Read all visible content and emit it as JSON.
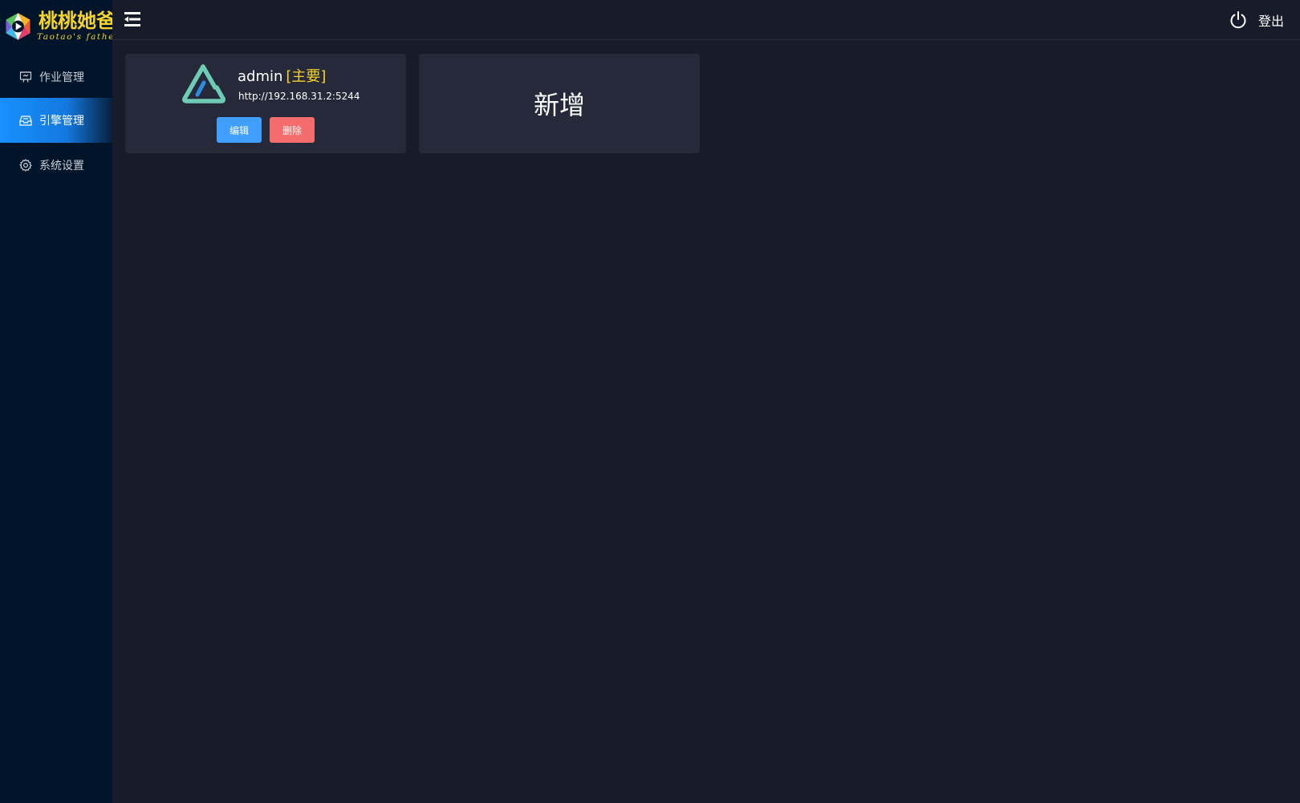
{
  "brand": {
    "name_cn": "桃桃她爸",
    "name_en": "Taotao's father",
    "color": "#f6d32b"
  },
  "sidebar": {
    "items": [
      {
        "label": "作业管理",
        "icon": "monitor-icon",
        "active": false
      },
      {
        "label": "引擎管理",
        "icon": "inbox-icon",
        "active": true
      },
      {
        "label": "系统设置",
        "icon": "gear-icon",
        "active": false
      }
    ]
  },
  "header": {
    "menu_icon": "menu-fold-icon",
    "logout_label": "登出",
    "logout_icon": "power-icon"
  },
  "engines": [
    {
      "name": "admin",
      "tag": "[主要]",
      "url": "http://192.168.31.2:5244",
      "edit_label": "编辑",
      "delete_label": "删除"
    }
  ],
  "add_card": {
    "label": "新增"
  },
  "colors": {
    "accent": "#1890ff",
    "edit": "#409eff",
    "delete": "#f56c6c",
    "sidebar_bg": "#001529",
    "content_bg": "#181b29",
    "card_bg": "#262939"
  }
}
